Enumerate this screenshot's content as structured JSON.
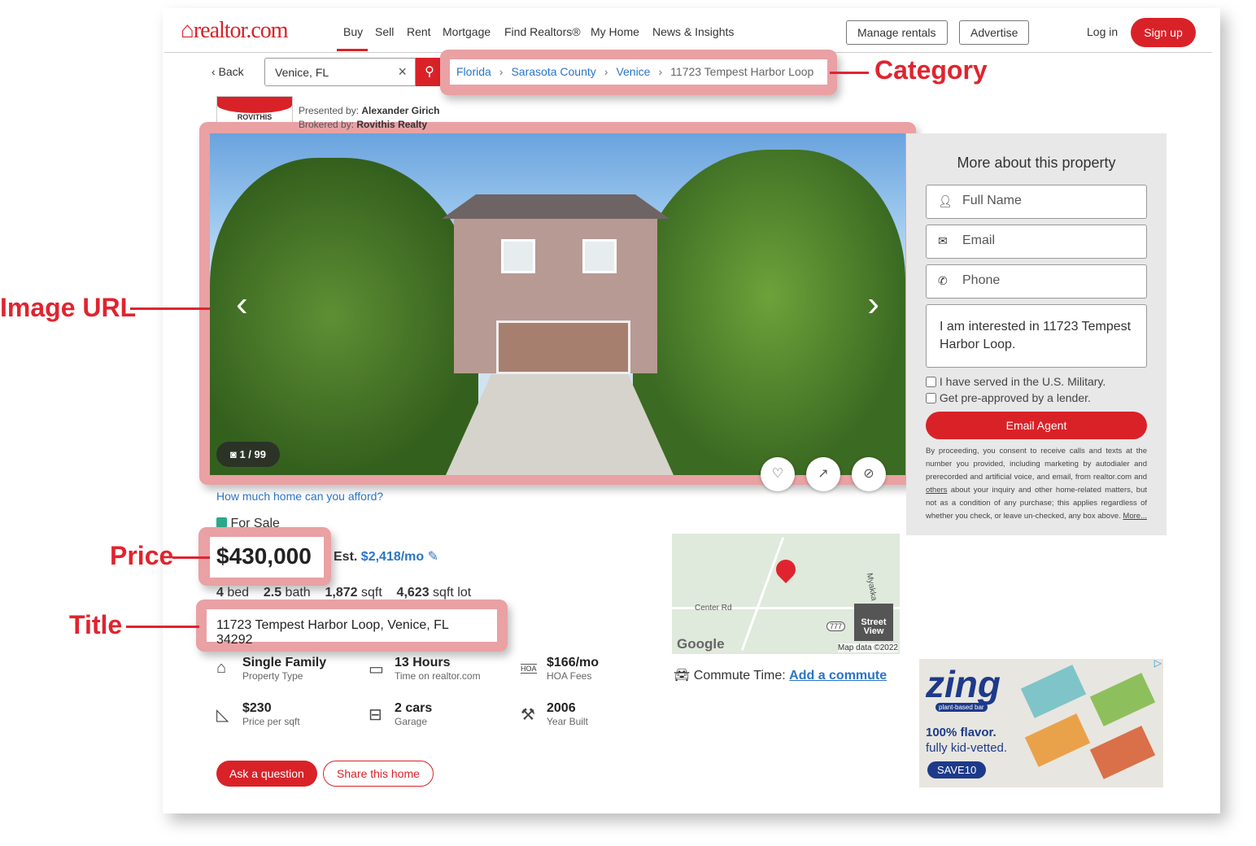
{
  "header": {
    "logo": "realtor.com",
    "nav": [
      "Buy",
      "Sell",
      "Rent",
      "Mortgage",
      "Find Realtors®",
      "My Home",
      "News & Insights"
    ],
    "manage_rentals": "Manage rentals",
    "advertise": "Advertise",
    "login": "Log in",
    "signup": "Sign up"
  },
  "search": {
    "back": "Back",
    "value": "Venice, FL"
  },
  "breadcrumbs": [
    "Florida",
    "Sarasota County",
    "Venice",
    "11723 Tempest Harbor Loop"
  ],
  "annotations": {
    "category": "Category",
    "image_url": "Image URL",
    "price": "Price",
    "title": "Title"
  },
  "broker": {
    "presented_label": "Presented by:",
    "presented": "Alexander Girich",
    "brokered_label": "Brokered by:",
    "brokered": "Rovithis Realty",
    "logo_text": "ROVITHIS REALTY"
  },
  "gallery": {
    "counter": "1 / 99"
  },
  "afford_link": "How much home can you afford?",
  "listing": {
    "status": "For Sale",
    "status_color": "#2aa88a",
    "price": "$430,000",
    "est_label": "Est.",
    "est": "$2,418/mo",
    "beds": "4",
    "beds_label": "bed",
    "baths": "2.5",
    "baths_label": "bath",
    "sqft": "1,872",
    "sqft_label": "sqft",
    "lot": "4,623",
    "lot_label": "sqft lot",
    "address": "11723 Tempest Harbor Loop, Venice, FL 34292"
  },
  "facts": [
    {
      "icon": "house-icon",
      "value": "Single Family",
      "label": "Property Type"
    },
    {
      "icon": "calendar-icon",
      "value": "13 Hours",
      "label": "Time on realtor.com"
    },
    {
      "icon": "hoa-icon",
      "value": "$166/mo",
      "label": "HOA Fees"
    },
    {
      "icon": "ruler-icon",
      "value": "$230",
      "label": "Price per sqft"
    },
    {
      "icon": "garage-icon",
      "value": "2 cars",
      "label": "Garage"
    },
    {
      "icon": "hammer-icon",
      "value": "2006",
      "label": "Year Built"
    }
  ],
  "actions": {
    "ask": "Ask a question",
    "share": "Share this home"
  },
  "map": {
    "road": "Center Rd",
    "road2": "Myakka",
    "route": "777",
    "street_view": "Street View",
    "google": "Google",
    "credit": "Map data ©2022"
  },
  "commute": {
    "label": "Commute Time:",
    "link": "Add a commute"
  },
  "form": {
    "title": "More about this property",
    "name": "Full Name",
    "email": "Email",
    "phone": "Phone",
    "message": "I am interested in 11723 Tempest Harbor Loop.",
    "military": "I have served in the U.S. Military.",
    "preapproved": "Get pre-approved by a lender.",
    "submit": "Email Agent",
    "disclaimer_1": "By proceeding, you consent to receive calls and texts at the number you provided, including marketing by autodialer and prerecorded and artificial voice, and email, from realtor.com and ",
    "others": "others",
    "disclaimer_2": " about your inquiry and other home-related matters, but not as a condition of any purchase; this applies regardless of whether you check, or leave un-checked, any box above. ",
    "more": "More..."
  },
  "ad": {
    "brand": "zing",
    "tag": "plant-based bar",
    "line1": "100% flavor.",
    "line2": "fully kid-vetted.",
    "code": "SAVE10"
  },
  "colors": {
    "brand": "#d92228",
    "link": "#2a74c8",
    "highlight": "#e9a1a4",
    "annotation": "#e0242f"
  }
}
